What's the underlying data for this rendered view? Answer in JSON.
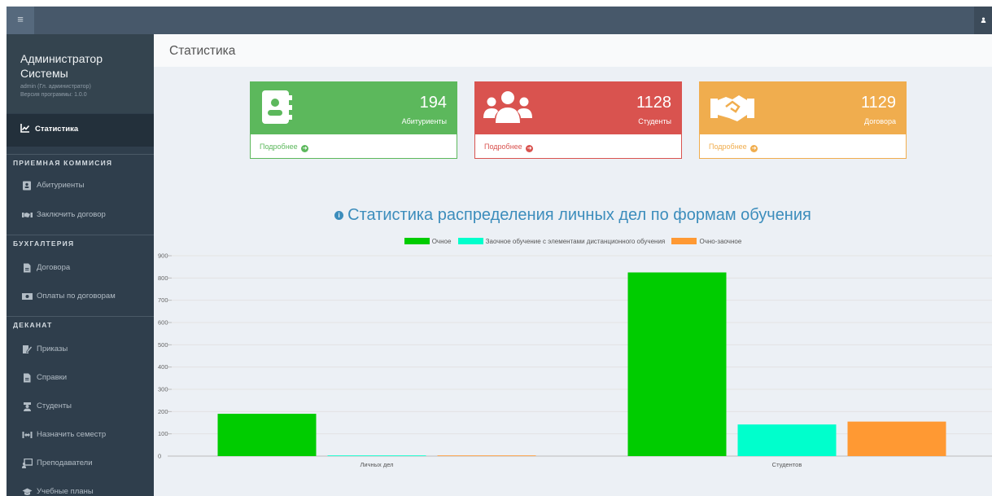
{
  "sidebar": {
    "user_name_line1": "Администратор",
    "user_name_line2": "Системы",
    "user_role": "admin (Гл. администратор)",
    "version": "Версия программы: 1.0.0",
    "active_item": "Статистика",
    "sections": [
      {
        "title": "ПРИЕМНАЯ КОММИСИЯ",
        "items": [
          "Абитуриенты",
          "Заключить договор"
        ]
      },
      {
        "title": "БУХГАЛТЕРИЯ",
        "items": [
          "Договора",
          "Оплаты по договорам"
        ]
      },
      {
        "title": "ДЕКАНАТ",
        "items": [
          "Приказы",
          "Справки",
          "Студенты",
          "Назначить семестр",
          "Преподаватели",
          "Учебные планы"
        ]
      }
    ]
  },
  "header": {
    "title": "Статистика"
  },
  "cards": [
    {
      "value": "194",
      "label": "Абитуриенты",
      "more": "Подробнее",
      "color": "#5cb85c",
      "icon": "contact-book-icon"
    },
    {
      "value": "1128",
      "label": "Студенты",
      "more": "Подробнее",
      "color": "#d9534f",
      "icon": "users-icon"
    },
    {
      "value": "1129",
      "label": "Договора",
      "more": "Подробнее",
      "color": "#f0ad4e",
      "icon": "handshake-icon"
    }
  ],
  "chart_title": "Статистика распределения личных дел по формам обучения",
  "chart_data": {
    "type": "bar",
    "categories": [
      "Личных дел",
      "Студентов"
    ],
    "series": [
      {
        "name": "Очное",
        "color": "#00cc00",
        "values": [
          190,
          825
        ]
      },
      {
        "name": "Заочное обучение с элементами дистанционного обучения",
        "color": "#00ffcc",
        "values": [
          2,
          142
        ]
      },
      {
        "name": "Очно-заочное",
        "color": "#ff9933",
        "values": [
          1,
          155
        ]
      }
    ],
    "ylim": [
      0,
      900
    ],
    "yticks": [
      0,
      100,
      200,
      300,
      400,
      500,
      600,
      700,
      800,
      900
    ],
    "grid": true,
    "legend": "top"
  }
}
